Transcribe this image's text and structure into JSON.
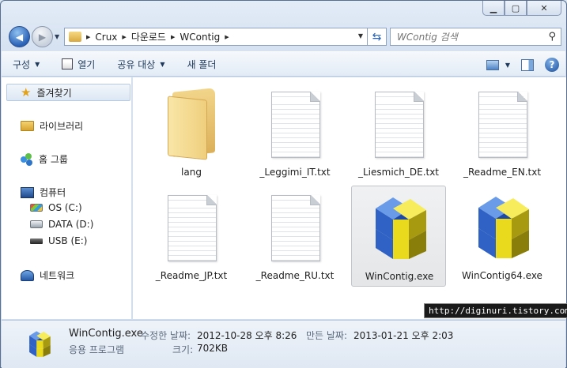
{
  "window": {
    "caption": {
      "minimize": "▁",
      "maximize": "▢",
      "close": "✕"
    }
  },
  "address": {
    "crumbs": [
      "Crux",
      "다운로드",
      "WContig"
    ]
  },
  "search": {
    "placeholder": "WContig 검색"
  },
  "toolbar": {
    "organize": "구성",
    "open": "열기",
    "share": "공유 대상",
    "new_folder": "새 폴더"
  },
  "sidebar": {
    "favorites": "즐겨찾기",
    "libraries": "라이브러리",
    "homegroup": "홈 그룹",
    "computer": "컴퓨터",
    "drives": [
      "OS (C:)",
      "DATA (D:)",
      "USB (E:)"
    ],
    "network": "네트워크"
  },
  "files": [
    {
      "name": "lang",
      "type": "folder"
    },
    {
      "name": "_Leggimi_IT.txt",
      "type": "txt"
    },
    {
      "name": "_Liesmich_DE.txt",
      "type": "txt"
    },
    {
      "name": "_Readme_EN.txt",
      "type": "txt"
    },
    {
      "name": "_Readme_JP.txt",
      "type": "txt"
    },
    {
      "name": "_Readme_RU.txt",
      "type": "txt"
    },
    {
      "name": "WinContig.exe",
      "type": "exe",
      "selected": true
    },
    {
      "name": "WinContig64.exe",
      "type": "exe"
    }
  ],
  "watermark": "http://diginuri.tistory.com",
  "details": {
    "name": "WinContig.exe",
    "type": "응용 프로그램",
    "modified_label": "수정한 날짜:",
    "modified": "2012-10-28 오후 8:26",
    "created_label": "만든 날짜:",
    "created": "2013-01-21 오후 2:03",
    "size_label": "크기:",
    "size": "702KB"
  },
  "colors": {
    "accent": "#2b62b6",
    "cube_blue": "#3a6fd0",
    "cube_yellow": "#f2e21a"
  }
}
